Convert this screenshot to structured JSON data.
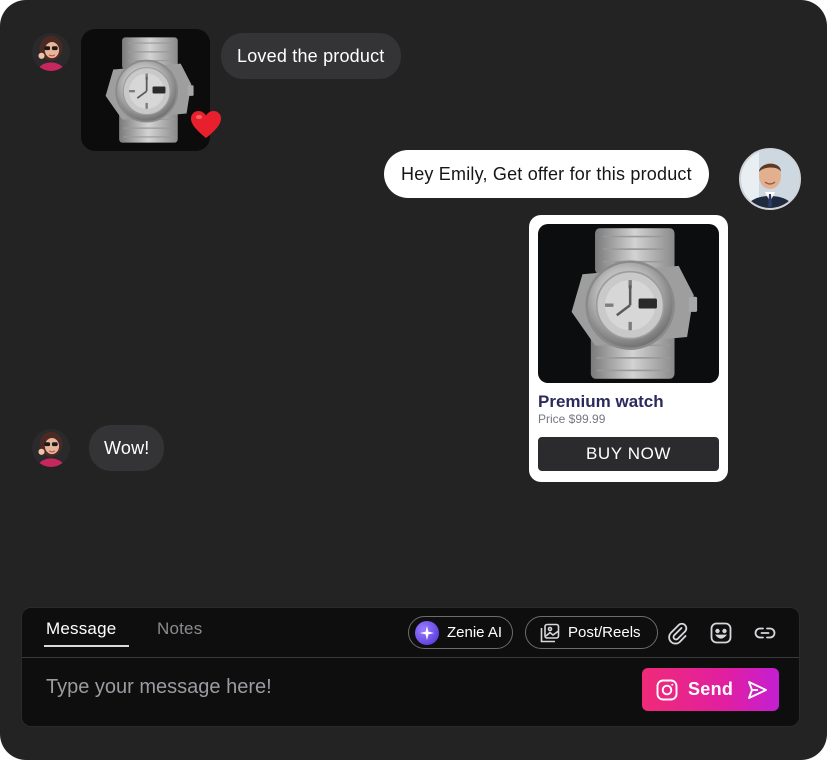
{
  "conversation": {
    "messages": [
      {
        "from": "customer",
        "type": "image",
        "reaction": "heart-icon"
      },
      {
        "from": "customer",
        "type": "text",
        "text": "Loved the product"
      },
      {
        "from": "agent",
        "type": "text",
        "text": "Hey Emily, Get offer for this product"
      },
      {
        "from": "agent",
        "type": "product_card"
      },
      {
        "from": "customer",
        "type": "text",
        "text": "Wow!"
      }
    ]
  },
  "product_card": {
    "title": "Premium watch",
    "price": "Price $99.99",
    "button_label": "BUY NOW"
  },
  "composer": {
    "tabs": [
      {
        "label": "Message",
        "active": true
      },
      {
        "label": "Notes",
        "active": false
      }
    ],
    "zenie_label": "Zenie AI",
    "post_reels_label": "Post/Reels",
    "placeholder": "Type your message here!",
    "send_label": "Send",
    "icons": [
      "sparkle-icon",
      "gallery-icon",
      "paperclip-icon",
      "sticker-icon",
      "link-icon",
      "instagram-icon",
      "send-arrow-icon"
    ]
  },
  "colors": {
    "background": "#232324",
    "incoming_bubble": "#343436",
    "outgoing_bubble": "#ffffff",
    "card_title": "#2a2a5c",
    "send_gradient_start": "#f02a78",
    "send_gradient_end": "#c41fd3"
  }
}
